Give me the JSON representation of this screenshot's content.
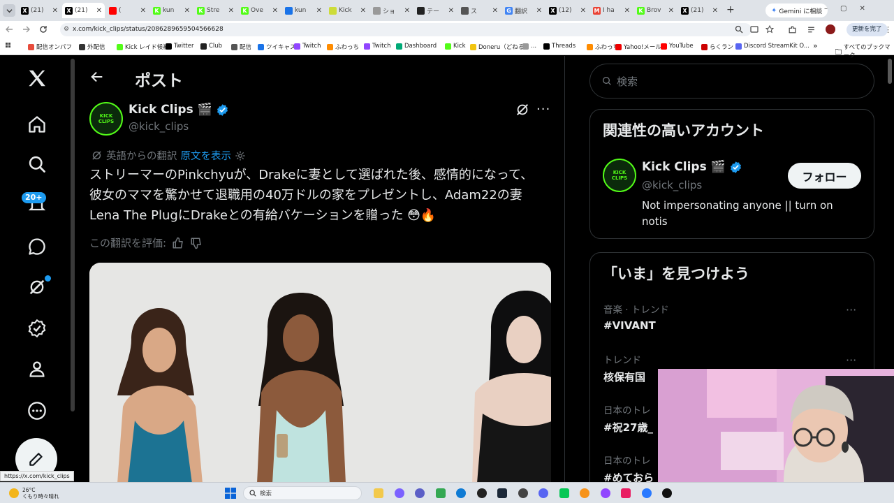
{
  "browser": {
    "tabs": [
      {
        "label": "(21)",
        "fav": "X",
        "color": "#000"
      },
      {
        "label": "(21)",
        "fav": "X",
        "color": "#000"
      },
      {
        "label": "(",
        "fav": "",
        "color": "#ff0000"
      },
      {
        "label": "kun",
        "fav": "K",
        "color": "#53fc18"
      },
      {
        "label": "Stre",
        "fav": "K",
        "color": "#53fc18"
      },
      {
        "label": "Ove",
        "fav": "K",
        "color": "#53fc18"
      },
      {
        "label": "kun",
        "fav": "",
        "color": "#1a73e8"
      },
      {
        "label": "Kick",
        "fav": "",
        "color": "#cddc39"
      },
      {
        "label": "ショ",
        "fav": "",
        "color": "#999"
      },
      {
        "label": "テー",
        "fav": "",
        "color": "#222"
      },
      {
        "label": "ス",
        "fav": "",
        "color": "#555"
      },
      {
        "label": "翻訳",
        "fav": "G",
        "color": "#4285f4"
      },
      {
        "label": "(12)",
        "fav": "X",
        "color": "#000"
      },
      {
        "label": "I ha",
        "fav": "M",
        "color": "#ea4335"
      },
      {
        "label": "Brov",
        "fav": "K",
        "color": "#53fc18"
      },
      {
        "label": "(21)",
        "fav": "X",
        "color": "#000"
      }
    ],
    "new_tab": "+",
    "gemini_label": "Gemini に相談",
    "url": "x.com/kick_clips/status/2086289659504566628",
    "update_label": "更新を完了",
    "bookmarks": [
      "配信オンパフ",
      "外配信",
      "Kick レイド候補",
      "Twitter",
      "Club",
      "配信",
      "ツイキャス",
      "Twitch",
      "ふわっち",
      "Twitch",
      "Dashboard",
      "Kick",
      "Doneru（どねる）",
      "...",
      "Threads",
      "ふわっち",
      "Yahoo!メール",
      "YouTube",
      "らくラン",
      "Discord StreamKit O..."
    ],
    "bookmarks_more": "»",
    "bookmarks_all": "すべてのブックマーク",
    "status_url": "https://x.com/kick_clips"
  },
  "twitter": {
    "page_title": "ポスト",
    "notif_badge": "20+",
    "post": {
      "display_name": "Kick Clips 🎬",
      "handle": "@kick_clips",
      "avatar_text": "KICK\nCLIPS",
      "translated_from": "英語からの翻訳",
      "show_original": "原文を表示",
      "text": "ストリーマーのPinkchyuが、Drakeに妻として選ばれた後、感情的になって、彼女のママを驚かせて退職用の40万ドルの家をプレゼントし、Adam22の妻Lena The PlugにDrakeとの有給バケーションを贈った 😳🔥",
      "rate_translation": "この翻訳を評価:"
    },
    "search_placeholder": "検索",
    "related": {
      "heading": "関連性の高いアカウント",
      "display_name": "Kick Clips 🎬",
      "handle": "@kick_clips",
      "bio": "Not impersonating anyone || turn on notis",
      "follow_label": "フォロー"
    },
    "trends": {
      "heading": "「いま」を見つけよう",
      "items": [
        {
          "category": "音楽 · トレンド",
          "name": "#VIVANT"
        },
        {
          "category": "トレンド",
          "name": "核保有国"
        },
        {
          "category": "日本のトレ",
          "name": "#祝27歳_"
        },
        {
          "category": "日本のトレ",
          "name": "#めておら"
        }
      ]
    }
  },
  "taskbar": {
    "weather_temp": "26°C",
    "weather_desc": "くもり時々晴れ",
    "search_placeholder": "検索"
  },
  "colors": {
    "verified": "#1d9bf0",
    "kick_green": "#53fc18",
    "link": "#1d9bf0"
  }
}
